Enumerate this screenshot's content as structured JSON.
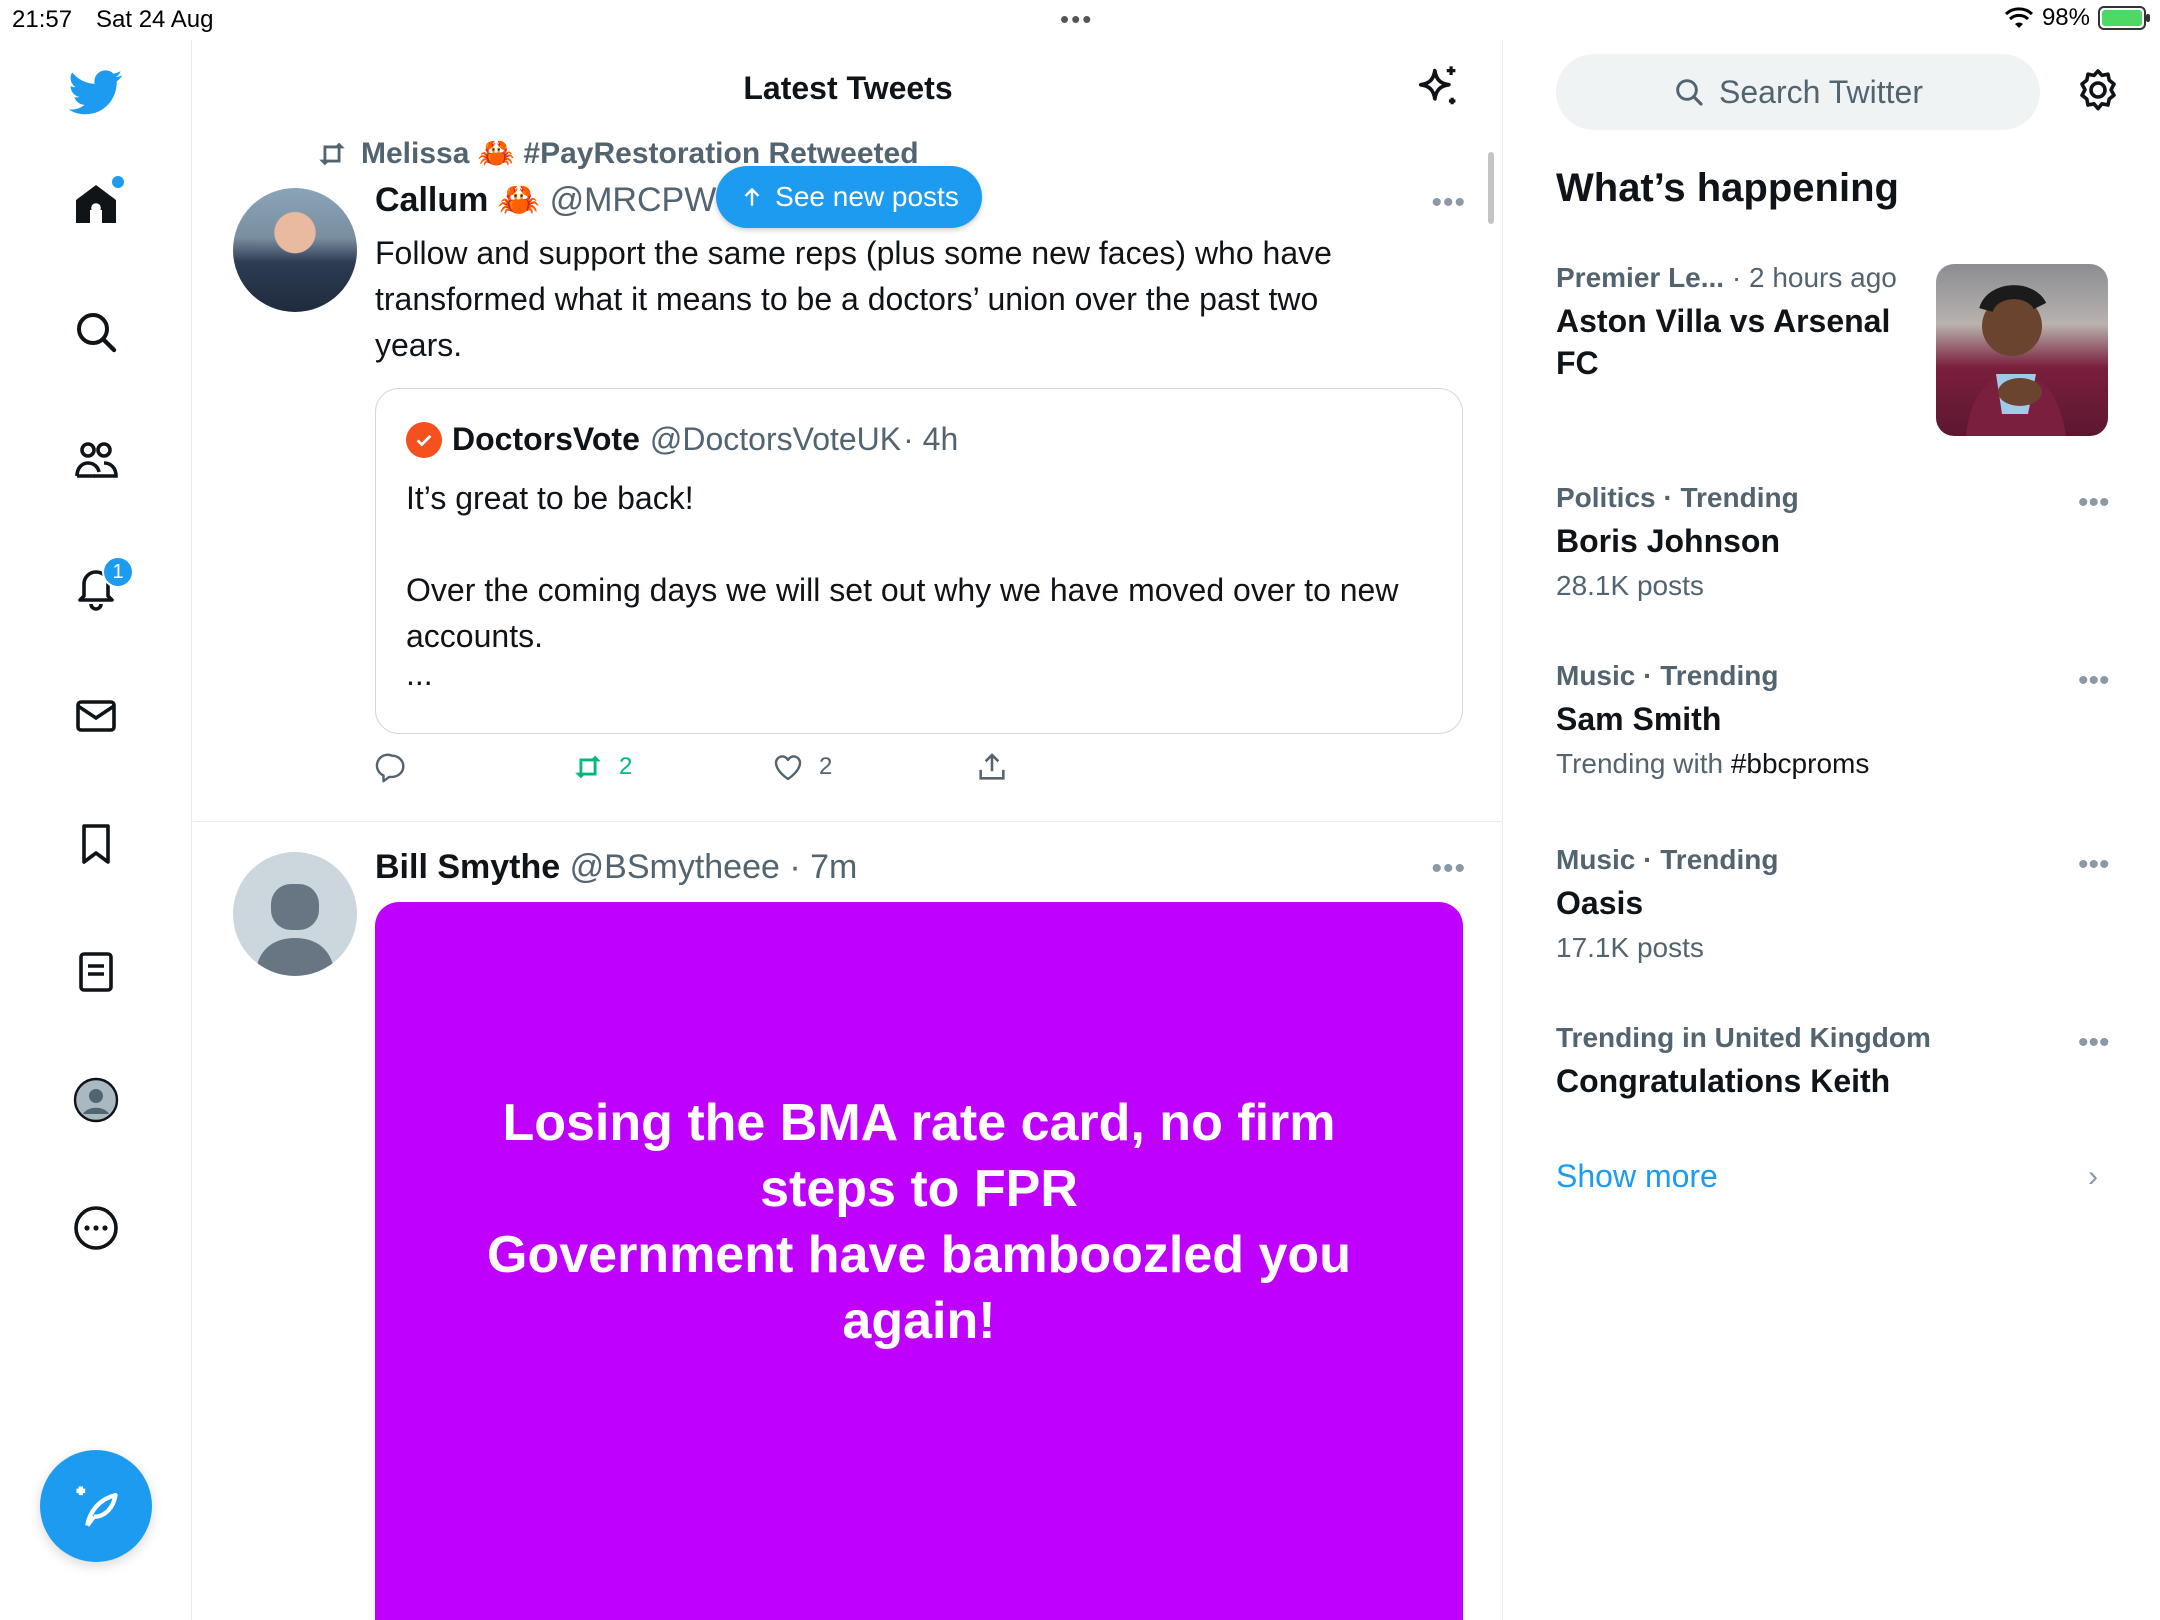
{
  "status_bar": {
    "time": "21:57",
    "date": "Sat 24 Aug",
    "battery": "98%"
  },
  "sidebar": {
    "notifications_badge": "1"
  },
  "main": {
    "title": "Latest Tweets",
    "new_posts_label": "See new posts",
    "tweet1": {
      "retweeted_by": "Melissa 🦀 #PayRestoration Retweeted",
      "name": "Callum 🦀",
      "handle": "@MRCPWo",
      "text": "Follow and support the same reps (plus some new faces) who have transformed what it means to be a doctors’ union over the past two years.",
      "quote": {
        "name": "DoctorsVote",
        "handle": "@DoctorsVoteUK",
        "time": "· 4h",
        "line1": "It’s great to be back!",
        "line2": "Over the coming days we will set out why we have moved over to new accounts.",
        "line3": "..."
      },
      "retweet_count": "2",
      "like_count": "2"
    },
    "tweet2": {
      "name": "Bill Smythe",
      "handle": "@BSmytheee",
      "time": "· 7m",
      "image_line1": "Losing the BMA rate card, no firm steps to FPR",
      "image_line2": "Government have bamboozled you again!"
    }
  },
  "right": {
    "search_placeholder": "Search Twitter",
    "heading": "What’s happening",
    "trends": [
      {
        "category": "Premier Le...",
        "meta_extra": " · 2 hours ago",
        "title": "Aston Villa vs Arsenal FC"
      },
      {
        "category": "Politics · Trending",
        "title": "Boris Johnson",
        "sub": "28.1K posts"
      },
      {
        "category": "Music · Trending",
        "title": "Sam Smith",
        "sub_prefix": "Trending with ",
        "sub_tag": "#bbcproms"
      },
      {
        "category": "Music · Trending",
        "title": "Oasis",
        "sub": "17.1K posts"
      },
      {
        "category": "Trending in United Kingdom",
        "title": "Congratulations Keith"
      }
    ],
    "show_more": "Show more"
  },
  "colors": {
    "accent": "#1d9bf0",
    "media_bg": "#c000ff",
    "retweet_green": "#00ba7c",
    "verified_orange": "#f4511e"
  }
}
